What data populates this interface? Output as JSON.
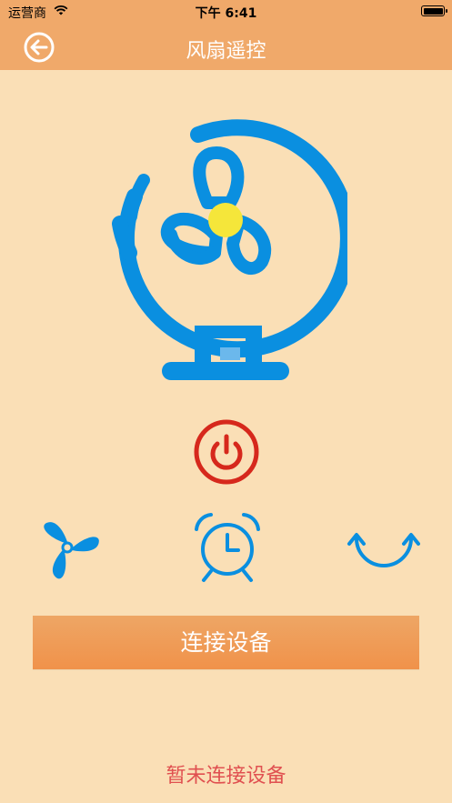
{
  "status_bar": {
    "carrier": "运营商",
    "time": "下午 6:41"
  },
  "nav": {
    "title": "风扇遥控",
    "back_icon": "back-arrow-circle-icon"
  },
  "illustration": {
    "name": "fan-illustration",
    "colors": {
      "fan": "#0a8fe0",
      "hub": "#f5e63a"
    }
  },
  "controls": {
    "power_icon": "power-icon",
    "power_color": "#d6281c",
    "speed_icon": "fan-speed-icon",
    "timer_icon": "alarm-clock-icon",
    "swing_icon": "swing-arrows-icon",
    "icon_color": "#0a8fe0"
  },
  "connect_button": {
    "label": "连接设备"
  },
  "connection_status": "暂未连接设备",
  "colors": {
    "background": "#fadfb6",
    "header": "#f0a96a",
    "status_text": "#e05050"
  }
}
